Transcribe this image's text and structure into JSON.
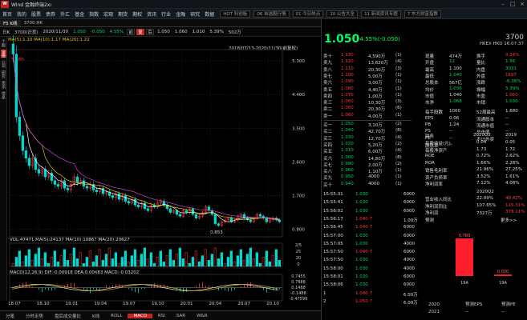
{
  "app": {
    "title": "Wind 金融终端2xxxx",
    "logo": "W"
  },
  "menubar": {
    "items": [
      "首页",
      "我的",
      "股票",
      "债券",
      "外汇",
      "基金",
      "指数",
      "宏观",
      "期货",
      "期权",
      "资讯",
      "行业",
      "金融",
      "研究",
      "数据"
    ],
    "boxes": [
      "HOT 科创板",
      "06 自选股行情",
      "01 今日热点",
      "10 公告大全",
      "11 新闻资讯专题",
      "7 东方财富指数"
    ]
  },
  "tabs": [
    "F5 K线",
    "3700.HK"
  ],
  "toolbar": {
    "period": "日K",
    "code_name": "3700(识货)",
    "date": "2020/11/30",
    "open": "1.050",
    "change": "-0.050",
    "change_pct": "4.55%",
    "buttons": [
      "前",
      "复",
      "后"
    ],
    "cells": [
      "1.050",
      "1.060",
      "1.010",
      "5.39%",
      "502万"
    ]
  },
  "left_strip": [
    "个股",
    "全景",
    "公司",
    "研究",
    "资讯",
    "信息"
  ],
  "chart_info": {
    "ma_label": "MA(5):1.10 MA(10):1.17 MA(20):1.22",
    "date_range": "2018/07/13-2020/11/30(前复权)",
    "max_label": "5.480",
    "min_label": "0.853",
    "vol_label": "VOL:47471 MA(5):24137 MA(10):10867 MA(20):20627",
    "macd_label": "MACD(12,26,9) DIF:-0.00918 DEA:0.00683 MACD:-0.03202"
  },
  "chart_data": {
    "type": "candlestick",
    "x_ticks": [
      "18.07",
      "18.10",
      "19.01",
      "19.04",
      "19.07",
      "19.10",
      "20.01",
      "20.04",
      "20.07",
      "20.10"
    ],
    "y_ticks": [
      5.3,
      4.4,
      3.5,
      2.6,
      1.7,
      0.8
    ],
    "ylim": [
      0.6,
      5.6
    ],
    "price_series": [
      5.48,
      3.8,
      3.3,
      2.9,
      2.7,
      2.5,
      2.7,
      2.4,
      2.3,
      2.4,
      2.2,
      2.3,
      2.1,
      2.0,
      1.95,
      2.1,
      1.9,
      1.85,
      2.0,
      2.2,
      2.05,
      2.1,
      1.95,
      1.9,
      2.0,
      1.85,
      1.8,
      1.9,
      1.75,
      1.8,
      1.7,
      1.65,
      1.75,
      1.6,
      1.7,
      1.55,
      1.5,
      1.6,
      1.45,
      1.4,
      1.5,
      1.35,
      1.3,
      1.45,
      1.4,
      1.5,
      1.55,
      1.45,
      1.35,
      1.25,
      1.3,
      1.2,
      1.15,
      1.3,
      1.25,
      1.35,
      1.2,
      1.1,
      1.15,
      1.25,
      1.4,
      1.3,
      1.2,
      0.95,
      0.9,
      1.0,
      1.05,
      1.1,
      1.0,
      1.05,
      1.15,
      1.2,
      1.1,
      1.05,
      1.0,
      1.1,
      1.2,
      1.15,
      1.1,
      1.0,
      1.05,
      1.1,
      1.05,
      1.0
    ],
    "vol_ticks": [
      "2/5",
      "25",
      "20",
      "0"
    ],
    "macd_ticks": [
      "0.7455",
      "0.7888",
      "0.1488",
      "-0.1488",
      "-0.47599"
    ]
  },
  "quote": {
    "price": "1.050",
    "change": "-4.55%(-0.050)",
    "code": "3700",
    "name_sub": "HKEX  HKD  16:07:37",
    "asks": [
      {
        "l": "卖十",
        "p": "1.130",
        "v": "4,590万",
        "n": "(1)"
      },
      {
        "l": "卖九",
        "p": "1.120",
        "v": "13,620万",
        "n": "(4)"
      },
      {
        "l": "卖八",
        "p": "1.110",
        "v": "20,30万",
        "n": "(3)"
      },
      {
        "l": "卖七",
        "p": "1.100",
        "v": "5,00万",
        "n": "(1)"
      },
      {
        "l": "卖六",
        "p": "1.090",
        "v": "3,00万",
        "n": "(1)"
      },
      {
        "l": "卖五",
        "p": "1.080",
        "v": "4,40万",
        "n": "(1)"
      },
      {
        "l": "卖四",
        "p": "1.070",
        "v": "1,00万",
        "n": "(1)"
      },
      {
        "l": "卖三",
        "p": "1.060",
        "v": "10,30万",
        "n": "(3)"
      },
      {
        "l": "卖二",
        "p": "1.060",
        "v": "20,30万",
        "n": "(6)"
      },
      {
        "l": "卖一",
        "p": "1.060",
        "v": "4,00万",
        "n": "(1)"
      }
    ],
    "bids": [
      {
        "l": "买一",
        "p": "1.050",
        "v": "3,10万",
        "n": "(2)"
      },
      {
        "l": "买二",
        "p": "1.040",
        "v": "42,70万",
        "n": "(8)"
      },
      {
        "l": "买三",
        "p": "1.030",
        "v": "12,70万",
        "n": "(4)"
      },
      {
        "l": "买四",
        "p": "1.020",
        "v": "5,20万",
        "n": "(2)"
      },
      {
        "l": "买五",
        "p": "1.010",
        "v": "6,00万",
        "n": "(4)"
      },
      {
        "l": "买六",
        "p": "1.000",
        "v": "14,80万",
        "n": "(8)"
      },
      {
        "l": "买七",
        "p": "0.990",
        "v": "2,00万",
        "n": "(2)"
      },
      {
        "l": "买八",
        "p": "0.960",
        "v": "1,10万",
        "n": "(1)"
      },
      {
        "l": "买九",
        "p": "0.950",
        "v": "4000",
        "n": "(1)"
      },
      {
        "l": "买十",
        "p": "0.940",
        "v": "4000",
        "n": "(1)"
      }
    ],
    "stats": [
      {
        "k": "现量",
        "v": "474万",
        "k2": "换手",
        "v2": "0.24%"
      },
      {
        "k": "开盘",
        "v": "12",
        "k2": "量比",
        "v2": "1.56"
      },
      {
        "k": "最高",
        "v": "1.100",
        "k2": "内盘",
        "v2": "3031"
      },
      {
        "k": "最低",
        "v": "1.040",
        "k2": "外盘",
        "v2": "1697"
      },
      {
        "k": "总股本",
        "v": "567亿",
        "k2": "涨跌",
        "v2": "-6.36%"
      },
      {
        "k": "均价",
        "v": "1.036",
        "k2": "振幅",
        "v2": "5.39%"
      },
      {
        "k": "市值",
        "v": "1.040",
        "k2": "市盈",
        "v2": "1.060"
      },
      {
        "k": "市净",
        "v": "1.068",
        "k2": "市销",
        "v2": "1.030"
      }
    ],
    "fin_stats": [
      {
        "k": "每手股数",
        "v": "1000",
        "k2": "52周最高",
        "v2": "1.680"
      },
      {
        "k": "EPS",
        "v": "0.06",
        "k2": "流通股本",
        "v2": "--"
      },
      {
        "k": "PB",
        "v": "1.24",
        "k2": "流通市值",
        "v2": "--"
      },
      {
        "k": "PS",
        "v": "--",
        "k2": "总市值",
        "v2": "--"
      },
      {
        "k": "PE",
        "v": "--",
        "k2": "不计外资",
        "v2": "--"
      },
      {
        "k": "股息率",
        "v": "--",
        "k2": "",
        "v2": ""
      }
    ]
  },
  "finance": {
    "header": [
      "财务",
      "2020Q2",
      "2019"
    ],
    "rows": [
      {
        "k": "每股收益(元)",
        "a": "0.04",
        "b": "0.05"
      },
      {
        "k": "每股净资产",
        "a": "1.73",
        "b": "1.72"
      },
      {
        "k": "ROE",
        "a": "0.72%",
        "b": "2.62%"
      },
      {
        "k": "ROA",
        "a": "1.66%",
        "b": "2.28%"
      },
      {
        "k": "销售毛利率",
        "a": "21.96%",
        "b": "27.25%"
      },
      {
        "k": "资产负债率",
        "a": "3.52%",
        "b": "1.61%"
      },
      {
        "k": "净利润率",
        "a": "7.12%",
        "b": "4.08%"
      }
    ],
    "header2": "2020Q2",
    "rows2": [
      {
        "k": "营业收入同比",
        "a": "22.09%",
        "b": "48.42%"
      },
      {
        "k": "净利润同比",
        "a": "107.65%",
        "b": "115.31%"
      },
      {
        "k": "净利润",
        "a": "7327万",
        "b": "378.11%"
      }
    ],
    "more": "更多>>",
    "forecast_label": "预测",
    "bars": [
      {
        "label": "19A",
        "value": 0.78,
        "text": "0.780"
      },
      {
        "label": "19A",
        "value": 0.03,
        "text": "0.030"
      }
    ],
    "bottom": [
      {
        "y": "2020",
        "a": "预测EPS",
        "b": "预测PE"
      },
      {
        "y": "2021",
        "a": "--",
        "b": "--"
      }
    ]
  },
  "trades": [
    {
      "t": "15:55:31",
      "p": "1.030",
      "v": "6000"
    },
    {
      "t": "15:55:41",
      "p": "1.030",
      "v": "6000"
    },
    {
      "t": "15:56:02",
      "p": "1.030",
      "v": "6000"
    },
    {
      "t": "15:56:17",
      "p": "1.040 ↑",
      "v": "1.00万"
    },
    {
      "t": "15:56:45",
      "p": "1.040 ↑",
      "v": "6000"
    },
    {
      "t": "15:57:00",
      "p": "1.030",
      "v": "6000"
    },
    {
      "t": "15:57:05",
      "p": "1.030",
      "v": "4000"
    },
    {
      "t": "15:57:50",
      "p": "1.040 ↑",
      "v": "6000"
    },
    {
      "t": "15:57:50",
      "p": "1.030",
      "v": "4000"
    },
    {
      "t": "15:58:00",
      "p": "1.030",
      "v": "4000"
    },
    {
      "t": "15:58:01",
      "p": "1.030",
      "v": "6000"
    },
    {
      "t": "15:58:06",
      "p": "1.030",
      "v": "6000"
    },
    {
      "t": "1",
      "p": "1.040 ↑",
      "v": "6.00万"
    },
    {
      "t": "2",
      "p": "1.050 ↑",
      "v": "6.00万"
    }
  ],
  "bottom_tabs": [
    "分笔",
    "分时走势",
    "盘后成交量比",
    "K线",
    "ROLL",
    "MACD",
    "RSI",
    "SAR",
    "W&R"
  ]
}
